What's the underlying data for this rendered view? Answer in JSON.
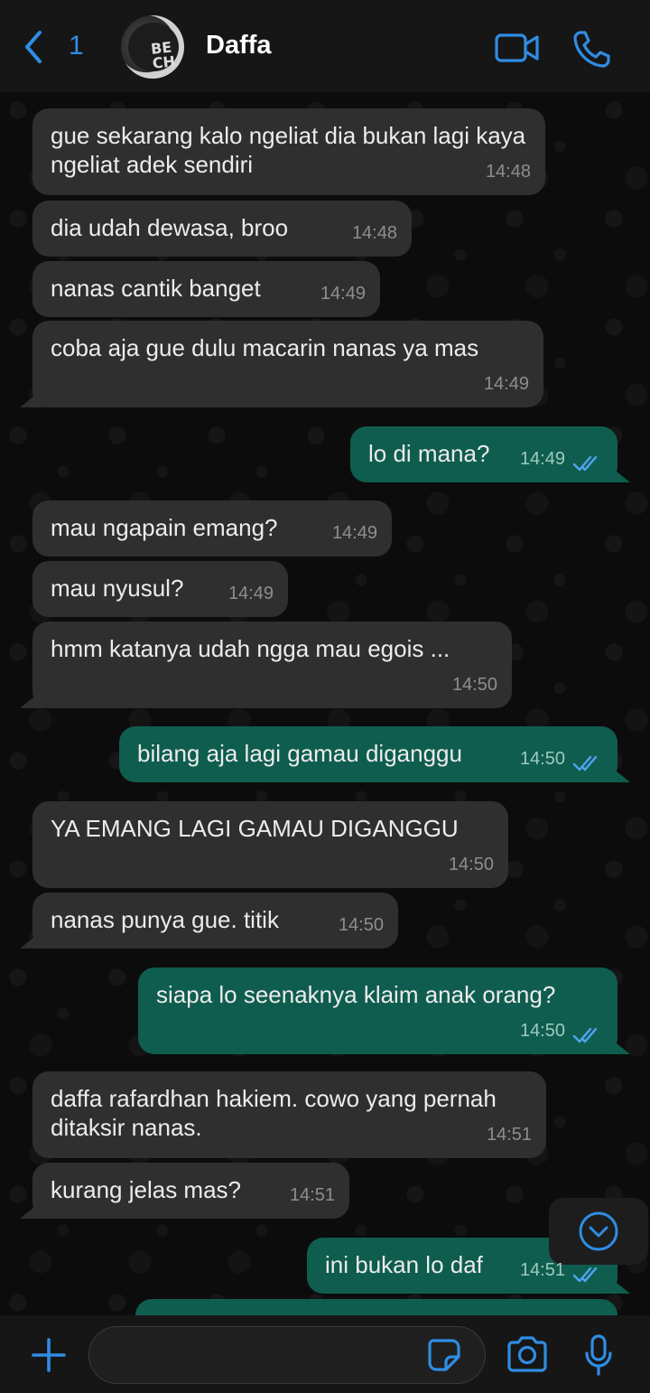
{
  "header": {
    "back_count": "1",
    "contact_name": "Daffa",
    "avatar_text": "BE CH"
  },
  "messages": [
    {
      "dir": "in",
      "text": "gue sekarang kalo ngeliat dia bukan lagi kaya ngeliat adek sendiri",
      "time": "14:48"
    },
    {
      "dir": "in",
      "text": "dia udah dewasa, broo",
      "time": "14:48"
    },
    {
      "dir": "in",
      "text": "nanas cantik banget",
      "time": "14:49"
    },
    {
      "dir": "in",
      "text": "coba aja gue dulu macarin nanas ya mas",
      "time": "14:49"
    },
    {
      "dir": "out",
      "text": "lo di mana?",
      "time": "14:49",
      "status": "read"
    },
    {
      "dir": "in",
      "text": "mau ngapain emang?",
      "time": "14:49"
    },
    {
      "dir": "in",
      "text": "mau nyusul?",
      "time": "14:49"
    },
    {
      "dir": "in",
      "text": "hmm katanya udah ngga mau egois ...",
      "time": "14:50"
    },
    {
      "dir": "out",
      "text": "bilang aja lagi gamau diganggu",
      "time": "14:50",
      "status": "read"
    },
    {
      "dir": "in",
      "text": "YA EMANG LAGI GAMAU DIGANGGU",
      "time": "14:50"
    },
    {
      "dir": "in",
      "text": "nanas punya gue. titik",
      "time": "14:50"
    },
    {
      "dir": "out",
      "text": "siapa lo seenaknya klaim anak orang?",
      "time": "14:50",
      "status": "read"
    },
    {
      "dir": "in",
      "text": "daffa rafardhan hakiem. cowo yang pernah ditaksir nanas.",
      "time": "14:51"
    },
    {
      "dir": "in",
      "text": "kurang jelas mas?",
      "time": "14:51"
    },
    {
      "dir": "out",
      "text": "ini bukan lo daf",
      "time": "14:51",
      "status": "read"
    }
  ],
  "composer": {
    "input_value": ""
  },
  "colors": {
    "accent": "#2f8de4",
    "incoming_bubble": "#2f2f2f",
    "outgoing_bubble": "#0f5d4e",
    "read_ticks": "#4fa3f0"
  },
  "icons": {
    "back": "chevron-left-icon",
    "video": "video-camera-icon",
    "call": "phone-icon",
    "scroll_down": "chevron-down-circle-icon",
    "attach": "plus-icon",
    "sticker": "sticker-icon",
    "camera": "camera-icon",
    "mic": "microphone-icon",
    "read_receipt": "double-check-icon"
  }
}
